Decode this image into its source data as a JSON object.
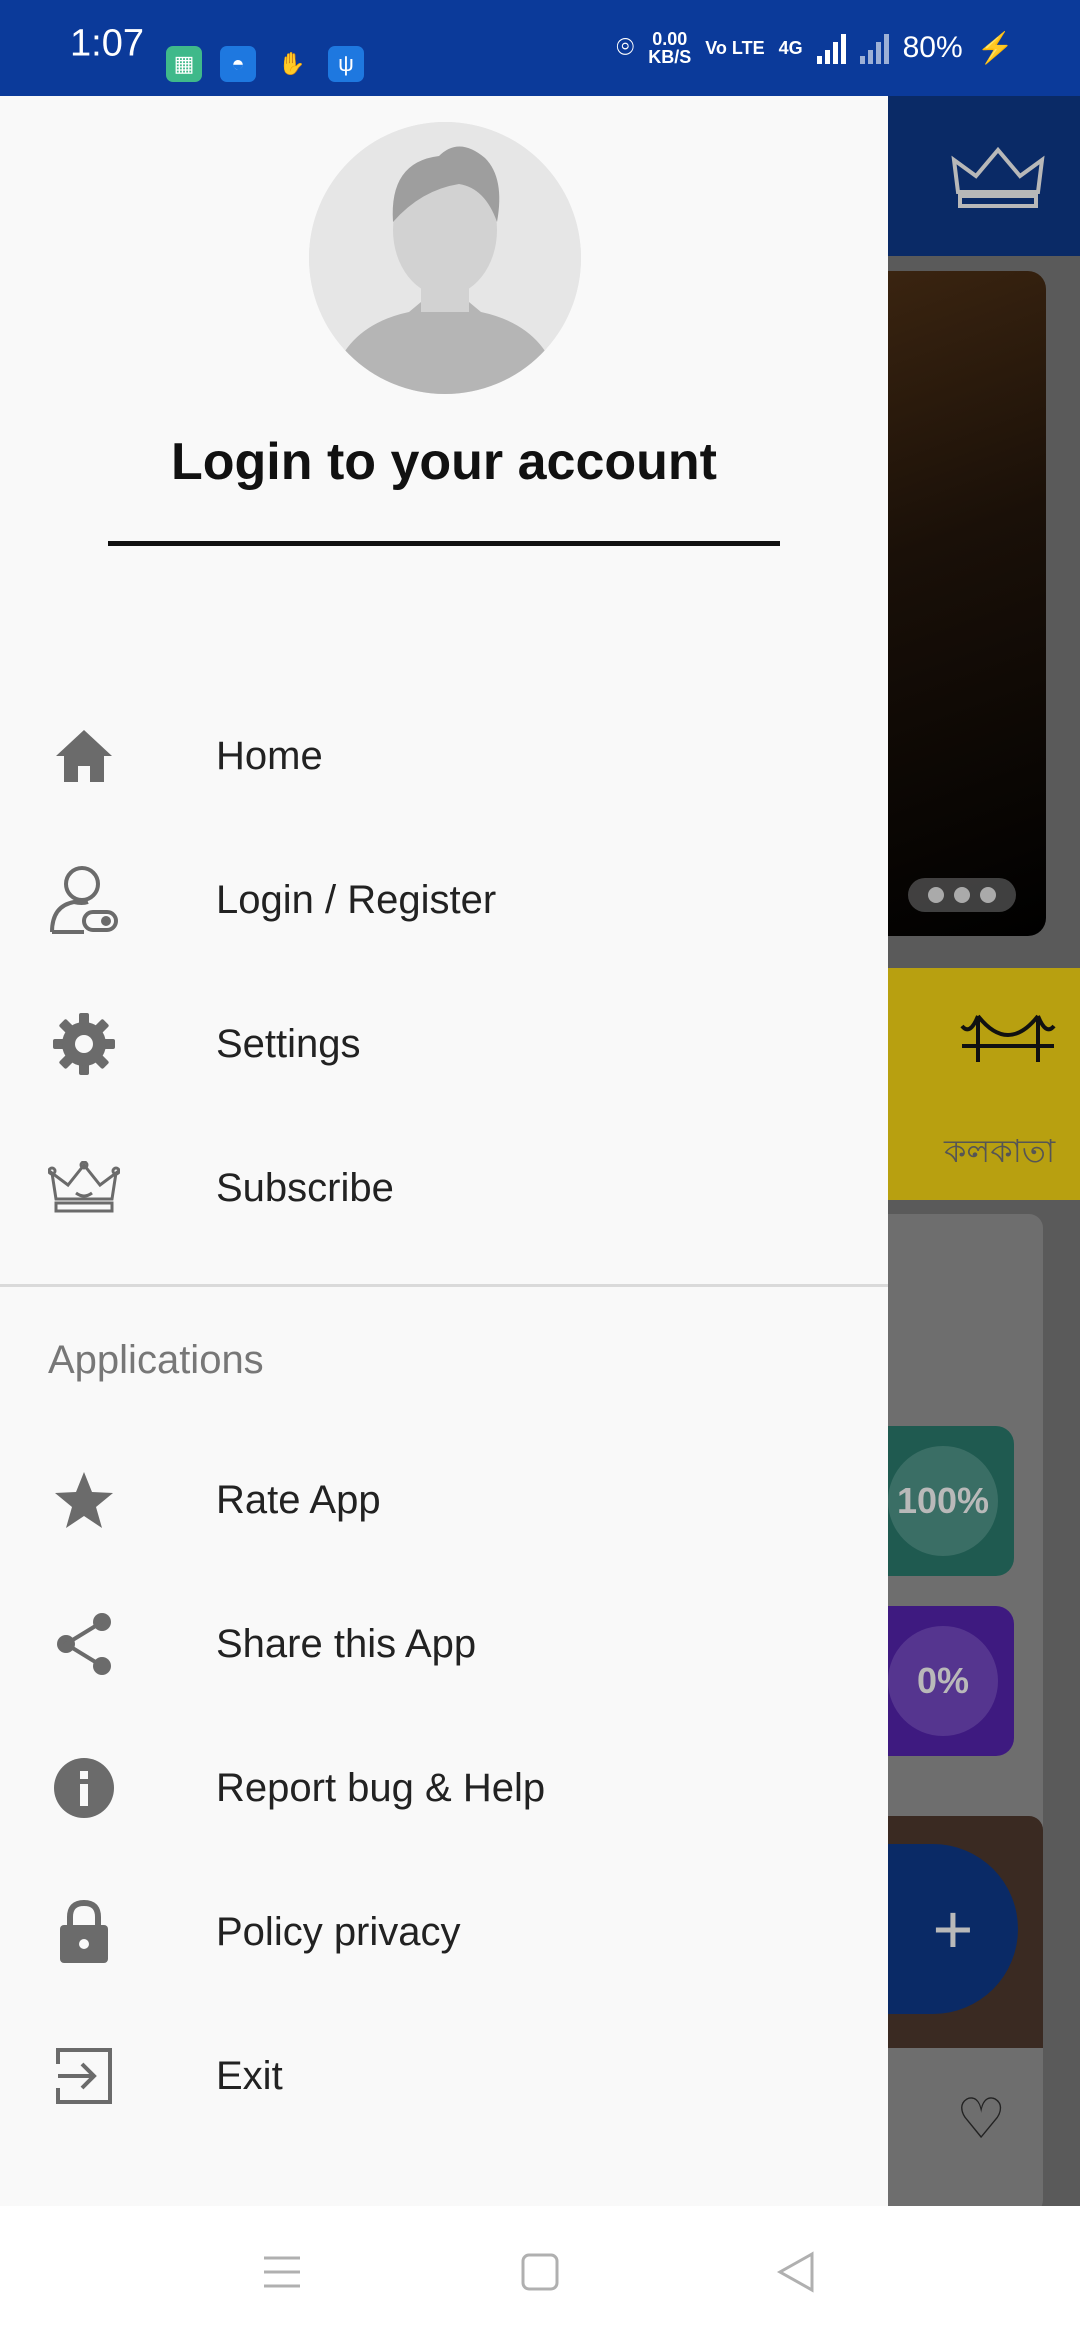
{
  "status_bar": {
    "time": "1:07",
    "net_speed_value": "0.00",
    "net_speed_unit": "KB/S",
    "volte": "Vo LTE",
    "network": "4G",
    "battery": "80%"
  },
  "drawer": {
    "header": {
      "title": "Login to your account"
    },
    "menu": [
      {
        "label": "Home",
        "icon": "home-icon"
      },
      {
        "label": "Login / Register",
        "icon": "user-key-icon"
      },
      {
        "label": "Settings",
        "icon": "gear-icon"
      },
      {
        "label": "Subscribe",
        "icon": "crown-icon"
      }
    ],
    "section_title": "Applications",
    "apps": [
      {
        "label": "Rate App",
        "icon": "star-icon"
      },
      {
        "label": "Share this App",
        "icon": "share-icon"
      },
      {
        "label": "Report bug & Help",
        "icon": "info-icon"
      },
      {
        "label": "Policy privacy",
        "icon": "lock-icon"
      },
      {
        "label": "Exit",
        "icon": "exit-icon"
      }
    ]
  },
  "background_app": {
    "city_label": "কলকাতা",
    "stat_1": "100%",
    "stat_2": "0%"
  },
  "colors": {
    "status_bar": "#0b3a9a",
    "drawer_bg": "#f9f9f9",
    "icon_gray": "#6b6b6b"
  }
}
